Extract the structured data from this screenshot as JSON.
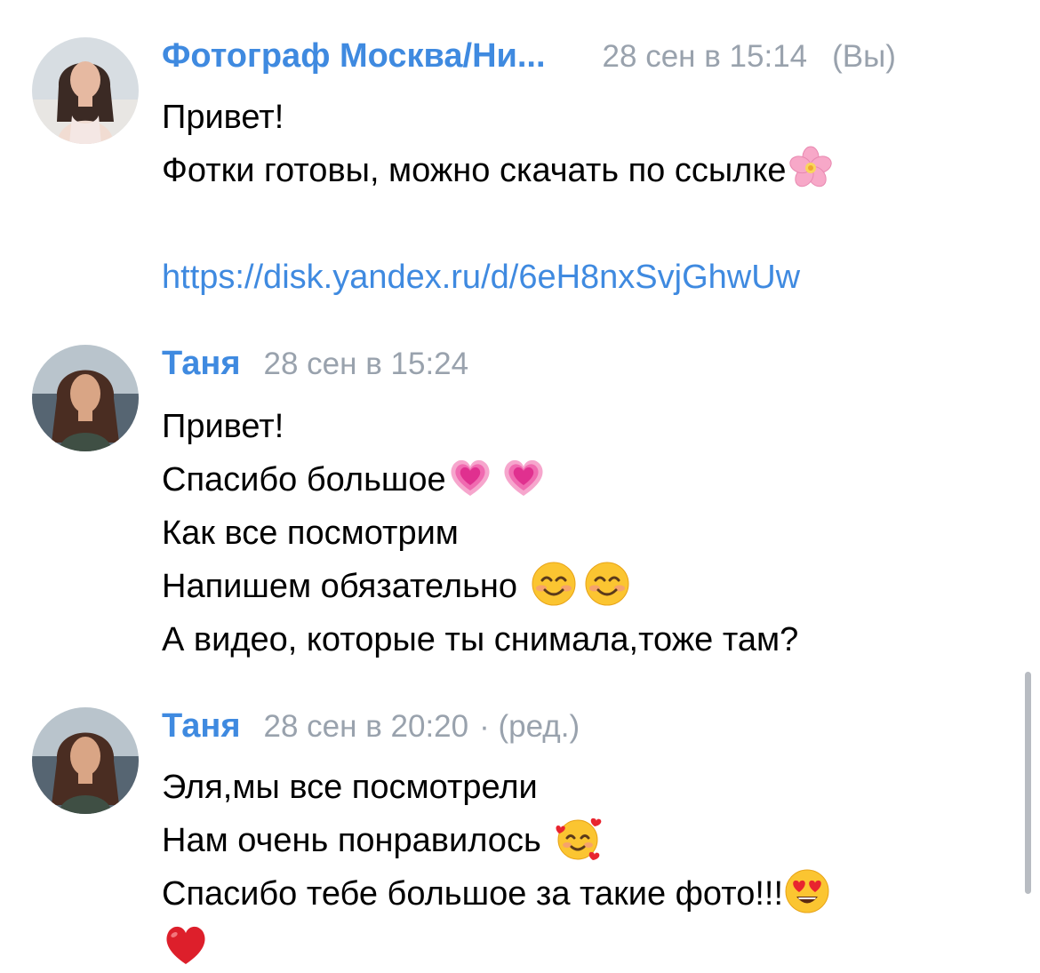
{
  "messages": [
    {
      "author": "Фотограф Москва/Ни...",
      "time": "28 сен в 15:14",
      "suffix": "(Вы)",
      "avatar": "avatar-photographer",
      "lines": [
        "Привет!",
        "Фотки готовы, можно скачать по ссылке"
      ],
      "link": "https://disk.yandex.ru/d/6eH8nxSvjGhwUw",
      "emoji": [
        "cherry-blossom-emoji"
      ]
    },
    {
      "author": "Таня",
      "time": "28 сен в 15:24",
      "avatar": "avatar-tanya",
      "lines": [
        "Привет!",
        "Спасибо большое",
        "Как все посмотрим",
        "Напишем обязательно",
        "А видео, которые ты снимала,тоже там?"
      ],
      "emoji": [
        "growing-heart-emoji",
        "growing-heart-emoji",
        "smiling-face-emoji",
        "smiling-face-emoji"
      ]
    },
    {
      "author": "Таня",
      "time": "28 сен в 20:20",
      "edited": "· (ред.)",
      "avatar": "avatar-tanya",
      "lines": [
        "Эля,мы все посмотрели",
        "Нам очень понравилось",
        "Спасибо тебе большое за такие фото!!!"
      ],
      "emoji": [
        "smiling-face-with-hearts-emoji",
        "heart-eyes-emoji",
        "red-heart-emoji"
      ]
    }
  ],
  "colors": {
    "accent": "#3f8ae0",
    "meta": "#99a2ad",
    "text": "#000000",
    "background": "#ffffff"
  }
}
